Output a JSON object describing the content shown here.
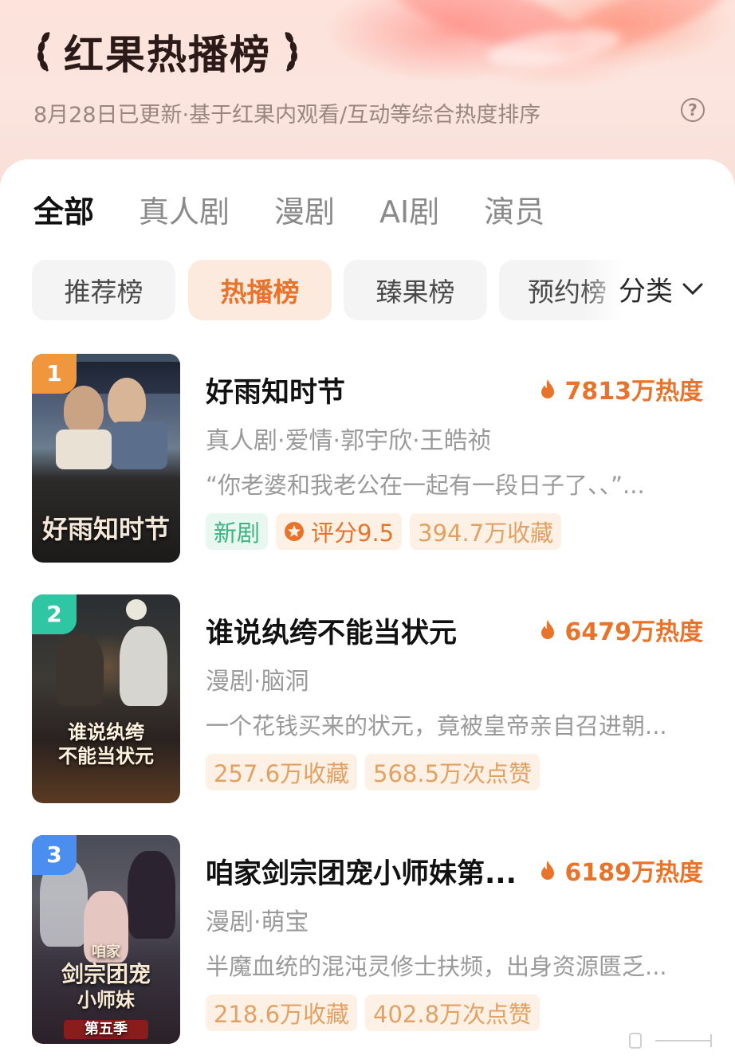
{
  "header": {
    "title": "红果热播榜",
    "subtitle": "8月28日已更新·基于红果内观看/互动等综合热度排序",
    "help_icon": "question-circle-icon"
  },
  "tabs": [
    {
      "label": "全部",
      "active": true
    },
    {
      "label": "真人剧",
      "active": false
    },
    {
      "label": "漫剧",
      "active": false
    },
    {
      "label": "AI剧",
      "active": false
    },
    {
      "label": "演员",
      "active": false
    }
  ],
  "chips": [
    {
      "label": "推荐榜",
      "active": false
    },
    {
      "label": "热播榜",
      "active": true
    },
    {
      "label": "臻果榜",
      "active": false
    },
    {
      "label": "预约榜",
      "active": false
    }
  ],
  "category_label": "分类",
  "items": [
    {
      "rank": "1",
      "name": "好雨知时节",
      "heat": "7813万热度",
      "meta": "真人剧·爱情·郭宇欣·王皓祯",
      "desc": "“你老婆和我老公在一起有一段日子了、、”...",
      "tag_new": "新剧",
      "tag_rating": "评分9.5",
      "tag_fav": "394.7万收藏",
      "cover_text": "好雨知时节"
    },
    {
      "rank": "2",
      "name": "谁说纨绔不能当状元",
      "heat": "6479万热度",
      "meta": "漫剧·脑洞",
      "desc": "一个花钱买来的状元，竟被皇帝亲自召进朝...",
      "tag_fav": "257.6万收藏",
      "tag_like": "568.5万次点赞",
      "cover_text_1": "谁说纨绔",
      "cover_text_2": "不能当状元"
    },
    {
      "rank": "3",
      "name": "咱家剑宗团宠小师妹第...",
      "heat": "6189万热度",
      "meta": "漫剧·萌宝",
      "desc": "半魔血统的混沌灵修士扶频，出身资源匮乏...",
      "tag_fav": "218.6万收藏",
      "tag_like": "402.8万次点赞",
      "cover_text_1": "咱家",
      "cover_text_2": "剑宗团宠",
      "cover_text_3": "小师妹",
      "cover_text_4": "第五季"
    }
  ],
  "colors": {
    "accent": "#e8742c",
    "rank1": "#f0963c",
    "rank2": "#2fc7a3",
    "rank3": "#4a8ef0"
  }
}
